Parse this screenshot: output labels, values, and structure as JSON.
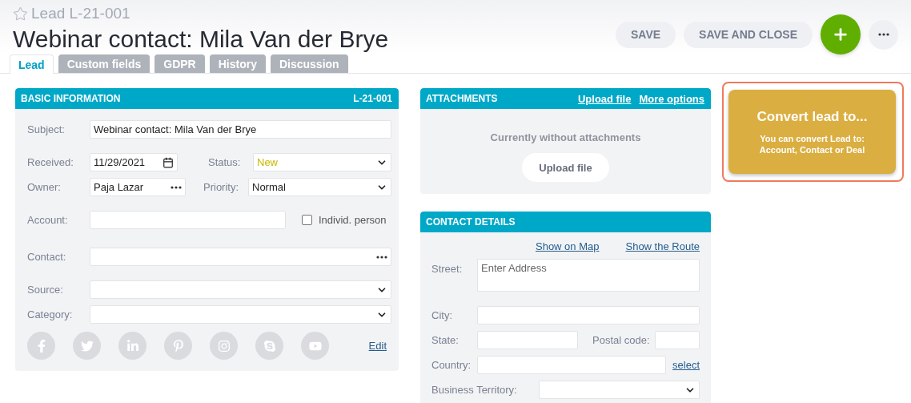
{
  "record": {
    "type_label": "Lead L-21-001",
    "starred": false,
    "title": "Webinar contact: Mila Van der Brye"
  },
  "actions": [
    {
      "label": "SAVE"
    },
    {
      "label": "SAVE AND CLOSE"
    }
  ],
  "tabs": [
    {
      "label": "Lead",
      "selected": true
    },
    {
      "label": "Custom fields",
      "selected": false
    },
    {
      "label": "GDPR",
      "selected": false
    },
    {
      "label": "History",
      "selected": false
    },
    {
      "label": "Discussion",
      "selected": false
    }
  ],
  "basic_information": {
    "title": "BASIC INFORMATION",
    "code": "L-21-001",
    "groups": [
      [
        [
          {
            "kind": "text",
            "label": "Subject:",
            "value": "Webinar contact: Mila Van der Brye"
          }
        ]
      ],
      [
        [
          {
            "kind": "date",
            "label": "Received:",
            "value": "11/29/2021"
          },
          {
            "kind": "select",
            "label": "Status:",
            "value": "New",
            "color": "#c9b800"
          }
        ],
        [
          {
            "kind": "lookup",
            "label": "Owner:",
            "value": "Paja Lazar"
          },
          {
            "kind": "select",
            "label": "Priority:",
            "value": "Normal",
            "color": "#222222"
          }
        ]
      ],
      [
        [
          {
            "kind": "text",
            "label": "Account:"
          },
          {
            "kind": "checkbox",
            "label": "Individ. person",
            "checked": false
          }
        ]
      ],
      [
        [
          {
            "kind": "lookup",
            "label": "Contact:"
          }
        ]
      ],
      [
        [
          {
            "kind": "select",
            "label": "Source:"
          }
        ],
        [
          {
            "kind": "select",
            "label": "Category:"
          }
        ]
      ]
    ],
    "edit_link": "Edit"
  },
  "attachments": {
    "title": "ATTACHMENTS",
    "links": [
      "Upload file",
      "More options"
    ],
    "empty_text": "Currently without attachments",
    "button": "Upload file"
  },
  "contact_details": {
    "title": "CONTACT DETAILS",
    "links": [
      "Show on Map",
      "Show the Route"
    ],
    "street": {
      "label": "Street:",
      "placeholder": "Enter Address"
    },
    "city": {
      "label": "City:"
    },
    "state": {
      "label": "State:"
    },
    "postal_code": {
      "label": "Postal code:"
    },
    "country": {
      "label": "Country:",
      "link": "select"
    },
    "territory": {
      "label": "Business Territory:"
    }
  },
  "convert": {
    "title": "Convert lead to...",
    "text": "You can convert Lead to: Account, Contact or Deal"
  }
}
